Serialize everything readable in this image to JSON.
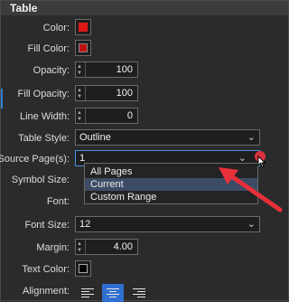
{
  "panel": {
    "title": "Table"
  },
  "fields": {
    "color": {
      "label": "Color:",
      "value_color": "#e01818"
    },
    "fill_color": {
      "label": "Fill Color:",
      "value_color": "#c01010"
    },
    "opacity": {
      "label": "Opacity:",
      "value": "100"
    },
    "fill_opacity": {
      "label": "Fill Opacity:",
      "value": "100"
    },
    "line_width": {
      "label": "Line Width:",
      "value": "0"
    },
    "table_style": {
      "label": "Table Style:",
      "value": "Outline"
    },
    "source_pages": {
      "label": "Source Page(s):",
      "value": "1"
    },
    "symbol_size": {
      "label": "Symbol Size:"
    },
    "font": {
      "label": "Font:"
    },
    "font_size": {
      "label": "Font Size:",
      "value": "12"
    },
    "margin": {
      "label": "Margin:",
      "value": "4.00"
    },
    "text_color": {
      "label": "Text Color:",
      "value_color": "#000000"
    },
    "alignment": {
      "label": "Alignment:",
      "selected": "center"
    }
  },
  "source_pages_menu": {
    "options": [
      "All Pages",
      "Current",
      "Custom Range"
    ],
    "highlighted": "Current"
  },
  "annotation": {
    "arrow_color": "#e8303a",
    "dot_color": "#d8323c"
  },
  "accent_color": "#2f7bd6"
}
